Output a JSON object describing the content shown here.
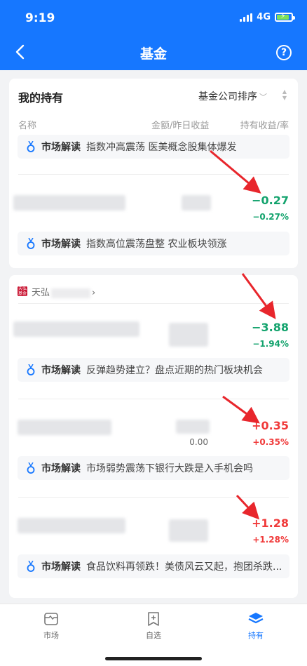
{
  "status": {
    "time": "9:19",
    "network": "4G"
  },
  "header": {
    "title": "基金",
    "help": "?"
  },
  "holdings": {
    "title": "我的持有",
    "sort_label": "基金公司排序",
    "columns": {
      "name": "名称",
      "amount": "金额/昨日收益",
      "profit": "持有收益/率"
    }
  },
  "insight_tag": "市场解读",
  "insights": [
    "指数冲高震荡 医美概念股集体爆发",
    "指数高位震荡盘整 农业板块领涨",
    "反弹趋势建立？盘点近期的热门板块机会",
    "市场弱势震荡下银行大跌是入手机会吗",
    "食品饮料再领跌！美债风云又起，抱团杀跌..."
  ],
  "company": {
    "name": "天弘",
    "logo_text": "天弘基金"
  },
  "funds": [
    {
      "profit": "−0.27",
      "rate": "−0.27%",
      "trend": "down"
    },
    {
      "profit": "−3.88",
      "rate": "−1.94%",
      "trend": "down"
    },
    {
      "profit": "+0.35",
      "rate": "+0.35%",
      "yesterday": "0.00",
      "trend": "up"
    },
    {
      "profit": "+1.28",
      "rate": "+1.28%",
      "trend": "up"
    }
  ],
  "colors": {
    "brand": "#1677ff",
    "down": "#13a36d",
    "up": "#f03a3a",
    "arrow": "#e8262c"
  },
  "nav": [
    {
      "label": "市场",
      "icon": "market-icon"
    },
    {
      "label": "自选",
      "icon": "watchlist-icon"
    },
    {
      "label": "持有",
      "icon": "holdings-icon",
      "active": true
    }
  ]
}
